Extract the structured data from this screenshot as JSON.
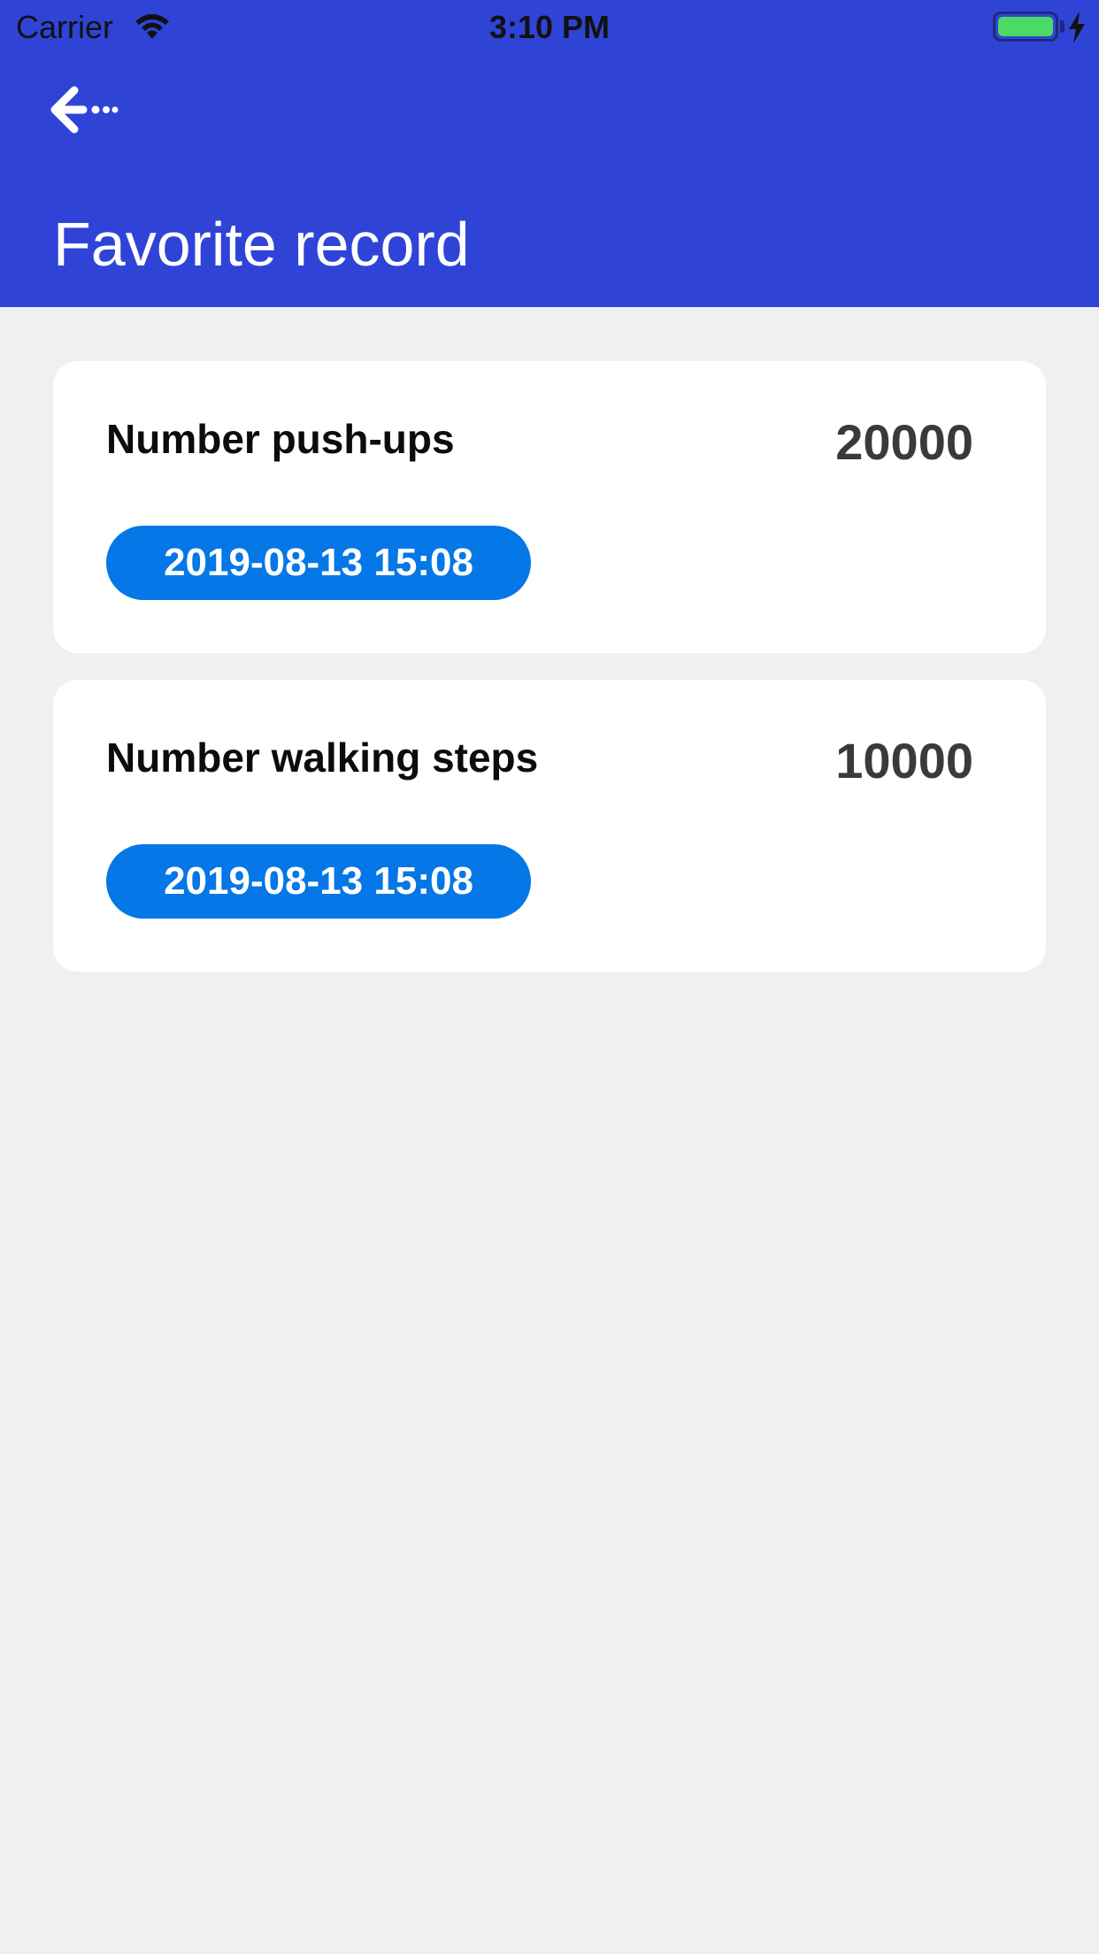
{
  "status_bar": {
    "carrier": "Carrier",
    "time": "3:10 PM",
    "battery_level": 1.0,
    "battery_color": "#4cd964"
  },
  "header": {
    "title": "Favorite record",
    "back_icon": "arrow-left-icon",
    "background_color": "#2f44d6"
  },
  "records": [
    {
      "label": "Number push-ups",
      "value": "20000",
      "date": "2019-08-13 15:08"
    },
    {
      "label": "Number walking steps",
      "value": "10000",
      "date": "2019-08-13 15:08"
    }
  ],
  "colors": {
    "accent": "#0577e6",
    "page_background": "#f0f0f0"
  }
}
